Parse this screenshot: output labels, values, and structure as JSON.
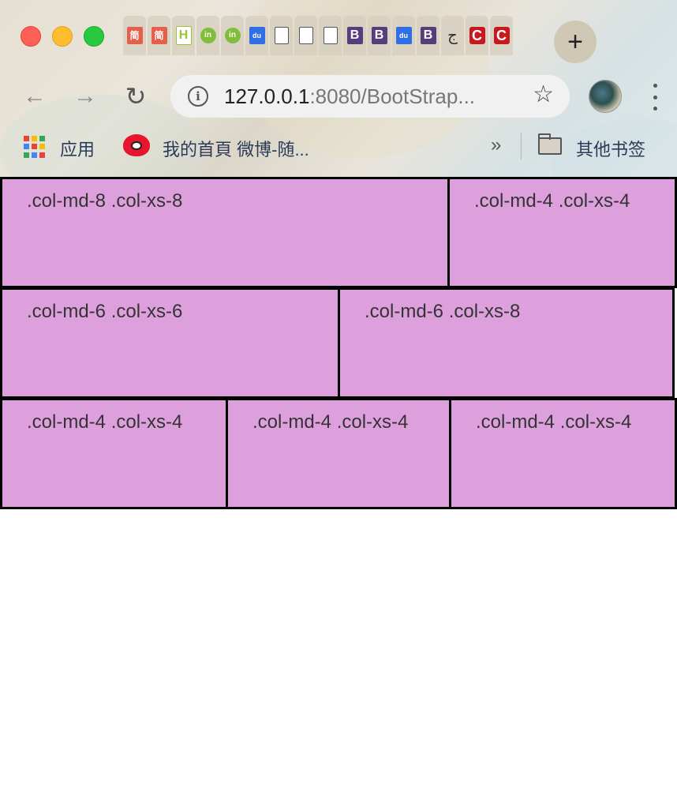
{
  "browser": {
    "tabs": [
      {
        "icon": "jianshu-icon",
        "glyph": "简"
      },
      {
        "icon": "jianshu-icon",
        "glyph": "简"
      },
      {
        "icon": "html-h-icon",
        "glyph": "H"
      },
      {
        "icon": "green-in-icon",
        "glyph": "in"
      },
      {
        "icon": "green-in-icon",
        "glyph": "in"
      },
      {
        "icon": "baidu-du-icon",
        "glyph": "du"
      },
      {
        "icon": "document-icon",
        "glyph": ""
      },
      {
        "icon": "document-icon",
        "glyph": ""
      },
      {
        "icon": "document-icon",
        "glyph": ""
      },
      {
        "icon": "bootstrap-b-icon",
        "glyph": "B"
      },
      {
        "icon": "bootstrap-b-icon",
        "glyph": "B"
      },
      {
        "icon": "baidu-du-icon",
        "glyph": "du"
      },
      {
        "icon": "bootstrap-b-icon",
        "glyph": "B"
      },
      {
        "icon": "hook-icon",
        "glyph": "ج"
      },
      {
        "icon": "csdn-c-icon",
        "glyph": "C"
      },
      {
        "icon": "csdn-c-icon",
        "glyph": "C"
      }
    ],
    "new_tab": "+",
    "url_host": "127.0.0.1",
    "url_rest": ":8080/BootStrap...",
    "bookmarks": {
      "apps_label": "应用",
      "weibo_label": "我的首頁 微博-随...",
      "overflow": "»",
      "other_label": "其他书签"
    }
  },
  "grid": {
    "rows": [
      {
        "cells": [
          ".col-md-8 .col-xs-8",
          ".col-md-4 .col-xs-4"
        ]
      },
      {
        "cells": [
          ".col-md-6 .col-xs-6",
          ".col-md-6 .col-xs-8"
        ]
      },
      {
        "cells": [
          ".col-md-4 .col-xs-4",
          ".col-md-4 .col-xs-4",
          ".col-md-4 .col-xs-4"
        ]
      }
    ]
  },
  "colors": {
    "cell_background": "#dda0dd",
    "cell_border": "#000000",
    "text": "#333333"
  }
}
